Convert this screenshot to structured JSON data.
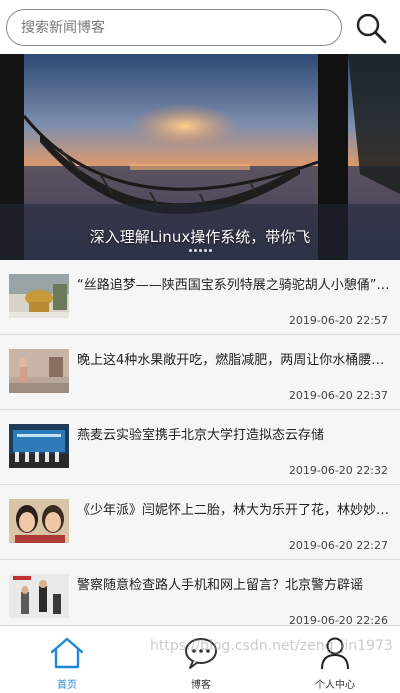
{
  "search": {
    "placeholder": "搜索新闻博客",
    "button_icon": "search-icon"
  },
  "banner": {
    "caption": "深入理解Linux操作系统，带你飞",
    "dots_count": 5
  },
  "news": [
    {
      "title": "“丝路追梦——陕西国宝系列特展之骑驼胡人小憩俑”开…",
      "time": "2019-06-20 22:57"
    },
    {
      "title": "晚上这4种水果敞开吃，燃脂减肥，两周让你水桶腰…",
      "time": "2019-06-20 22:37"
    },
    {
      "title": "燕麦云实验室携手北京大学打造拟态云存储",
      "time": "2019-06-20 22:32"
    },
    {
      "title": "《少年派》闫妮怀上二胎，林大为乐开了花，林妙妙…",
      "time": "2019-06-20 22:27"
    },
    {
      "title": "警察随意检查路人手机和网上留言？北京警方辟谣",
      "time": "2019-06-20 22:26"
    }
  ],
  "tabs": [
    {
      "label": "首页",
      "icon": "home-icon",
      "active": true
    },
    {
      "label": "博客",
      "icon": "chat-bubble-icon",
      "active": false
    },
    {
      "label": "个人中心",
      "icon": "user-icon",
      "active": false
    }
  ],
  "watermark": "https://blog.csdn.net/zeng_jin1973",
  "colors": {
    "accent": "#1e88d8",
    "text": "#222222",
    "time": "#444444"
  }
}
